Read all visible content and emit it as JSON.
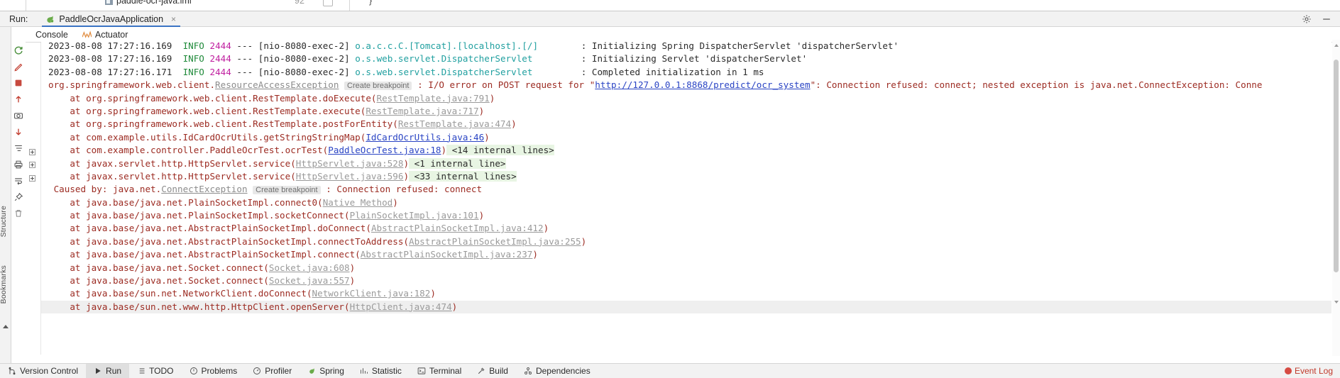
{
  "editor_strip": {
    "tab_label": "paddle-ocr-java.iml",
    "right_number": "92",
    "brace": "}"
  },
  "run_panel": {
    "run_label": "Run:",
    "tab_title": "PaddleOcrJavaApplication",
    "tab_close": "×",
    "subtabs": [
      {
        "label": "Console",
        "icon": "console-icon"
      },
      {
        "label": "Actuator",
        "icon": "actuator-chart-icon"
      }
    ],
    "header_icons": [
      "settings-gear-icon",
      "minimize-icon"
    ],
    "toolbar_icons": [
      "rerun-icon",
      "modify-run-icon",
      "stop-icon",
      "up-arrow-icon",
      "camera-icon",
      "down-arrow-icon",
      "filter-icon",
      "print-icon",
      "scroll-to-end-icon",
      "soft-wrap-icon",
      "pin-icon",
      "trash-icon"
    ]
  },
  "left_rail": {
    "structure_label": "Structure",
    "bookmarks_label": "Bookmarks"
  },
  "console": {
    "lines": [
      {
        "type": "log",
        "timestamp": "2023-08-08 17:27:16.169",
        "level": "INFO",
        "pid": "2444",
        "sep": "---",
        "thread": "[nio-8080-exec-2]",
        "logger": "o.a.c.c.C.[Tomcat].[localhost].[/]",
        "message": ": Initializing Spring DispatcherServlet 'dispatcherServlet'"
      },
      {
        "type": "log",
        "timestamp": "2023-08-08 17:27:16.169",
        "level": "INFO",
        "pid": "2444",
        "sep": "---",
        "thread": "[nio-8080-exec-2]",
        "logger": "o.s.web.servlet.DispatcherServlet",
        "message": ": Initializing Servlet 'dispatcherServlet'"
      },
      {
        "type": "log",
        "timestamp": "2023-08-08 17:27:16.171",
        "level": "INFO",
        "pid": "2444",
        "sep": "---",
        "thread": "[nio-8080-exec-2]",
        "logger": "o.s.web.servlet.DispatcherServlet",
        "message": ": Completed initialization in 1 ms"
      },
      {
        "type": "exception-head",
        "package": "org.springframework.web.client.",
        "exception": "ResourceAccessException",
        "breakpoint": "Create breakpoint",
        "pre_url": " : I/O error on POST request for \"",
        "url": "http://127.0.0.1:8868/predict/ocr_system",
        "post_url": "\": Connection refused: connect; nested exception is java.net.ConnectException: Conne"
      },
      {
        "type": "frame",
        "text": "    at org.springframework.web.client.RestTemplate.doExecute(",
        "link": "RestTemplate.java:791",
        "link_style": "gray",
        "tail": ")",
        "fold": false
      },
      {
        "type": "frame",
        "text": "    at org.springframework.web.client.RestTemplate.execute(",
        "link": "RestTemplate.java:717",
        "link_style": "gray",
        "tail": ")",
        "fold": false
      },
      {
        "type": "frame",
        "text": "    at org.springframework.web.client.RestTemplate.postForEntity(",
        "link": "RestTemplate.java:474",
        "link_style": "gray",
        "tail": ")",
        "fold": false
      },
      {
        "type": "frame",
        "text": "    at com.example.utils.IdCardOcrUtils.getStringStringMap(",
        "link": "IdCardOcrUtils.java:46",
        "link_style": "blue",
        "tail": ")",
        "fold": false
      },
      {
        "type": "frame",
        "text": "    at com.example.controller.PaddleOcrTest.ocrTest(",
        "link": "PaddleOcrTest.java:18",
        "link_style": "blue",
        "tail": ")",
        "internal": " <14 internal lines>",
        "fold": true
      },
      {
        "type": "frame",
        "text": "    at javax.servlet.http.HttpServlet.service(",
        "link": "HttpServlet.java:528",
        "link_style": "gray",
        "tail": ")",
        "internal": " <1 internal line>",
        "fold": true
      },
      {
        "type": "frame",
        "text": "    at javax.servlet.http.HttpServlet.service(",
        "link": "HttpServlet.java:596",
        "link_style": "gray",
        "tail": ")",
        "internal": " <33 internal lines>",
        "fold": true
      },
      {
        "type": "caused-by",
        "prefix": " Caused by: java.net.",
        "exception": "ConnectException",
        "breakpoint": "Create breakpoint",
        "message": " : Connection refused: connect"
      },
      {
        "type": "frame",
        "text": "    at java.base/java.net.PlainSocketImpl.connect0(",
        "link": "Native Method",
        "link_style": "gray",
        "tail": ")",
        "fold": false
      },
      {
        "type": "frame",
        "text": "    at java.base/java.net.PlainSocketImpl.socketConnect(",
        "link": "PlainSocketImpl.java:101",
        "link_style": "gray",
        "tail": ")",
        "fold": false
      },
      {
        "type": "frame",
        "text": "    at java.base/java.net.AbstractPlainSocketImpl.doConnect(",
        "link": "AbstractPlainSocketImpl.java:412",
        "link_style": "gray",
        "tail": ")",
        "fold": false
      },
      {
        "type": "frame",
        "text": "    at java.base/java.net.AbstractPlainSocketImpl.connectToAddress(",
        "link": "AbstractPlainSocketImpl.java:255",
        "link_style": "gray",
        "tail": ")",
        "fold": false
      },
      {
        "type": "frame",
        "text": "    at java.base/java.net.AbstractPlainSocketImpl.connect(",
        "link": "AbstractPlainSocketImpl.java:237",
        "link_style": "gray",
        "tail": ")",
        "fold": false
      },
      {
        "type": "frame",
        "text": "    at java.base/java.net.Socket.connect(",
        "link": "Socket.java:608",
        "link_style": "gray",
        "tail": ")",
        "fold": false
      },
      {
        "type": "frame",
        "text": "    at java.base/java.net.Socket.connect(",
        "link": "Socket.java:557",
        "link_style": "gray",
        "tail": ")",
        "fold": false
      },
      {
        "type": "frame",
        "text": "    at java.base/sun.net.NetworkClient.doConnect(",
        "link": "NetworkClient.java:182",
        "link_style": "gray",
        "tail": ")",
        "fold": false
      },
      {
        "type": "frame",
        "text": "    at java.base/sun.net.www.http.HttpClient.openServer(",
        "link": "HttpClient.java:474",
        "link_style": "gray",
        "tail": ")",
        "fold": false,
        "highlight": true
      }
    ]
  },
  "statusbar": {
    "items": [
      {
        "label": "Version Control",
        "icon": "branch-icon",
        "active": false
      },
      {
        "label": "Run",
        "icon": "play-icon",
        "active": true
      },
      {
        "label": "TODO",
        "icon": "list-icon",
        "active": false
      },
      {
        "label": "Problems",
        "icon": "warning-icon",
        "active": false
      },
      {
        "label": "Profiler",
        "icon": "gauge-icon",
        "active": false
      },
      {
        "label": "Spring",
        "icon": "leaf-icon",
        "active": false
      },
      {
        "label": "Statistic",
        "icon": "stats-icon",
        "active": false
      },
      {
        "label": "Terminal",
        "icon": "terminal-icon",
        "active": false
      },
      {
        "label": "Build",
        "icon": "hammer-icon",
        "active": false
      },
      {
        "label": "Dependencies",
        "icon": "dependency-icon",
        "active": false
      }
    ],
    "right": {
      "label": "Event Log",
      "icon": "error-dot-icon"
    }
  },
  "colors": {
    "accent": "#3b74c4",
    "info_green": "#1f8a3a",
    "pid_magenta": "#c020a0",
    "logger_teal": "#21a0a0",
    "error_red": "#9c2b22",
    "link_blue": "#2a44c4",
    "internal_bg": "#e8f5e3"
  }
}
